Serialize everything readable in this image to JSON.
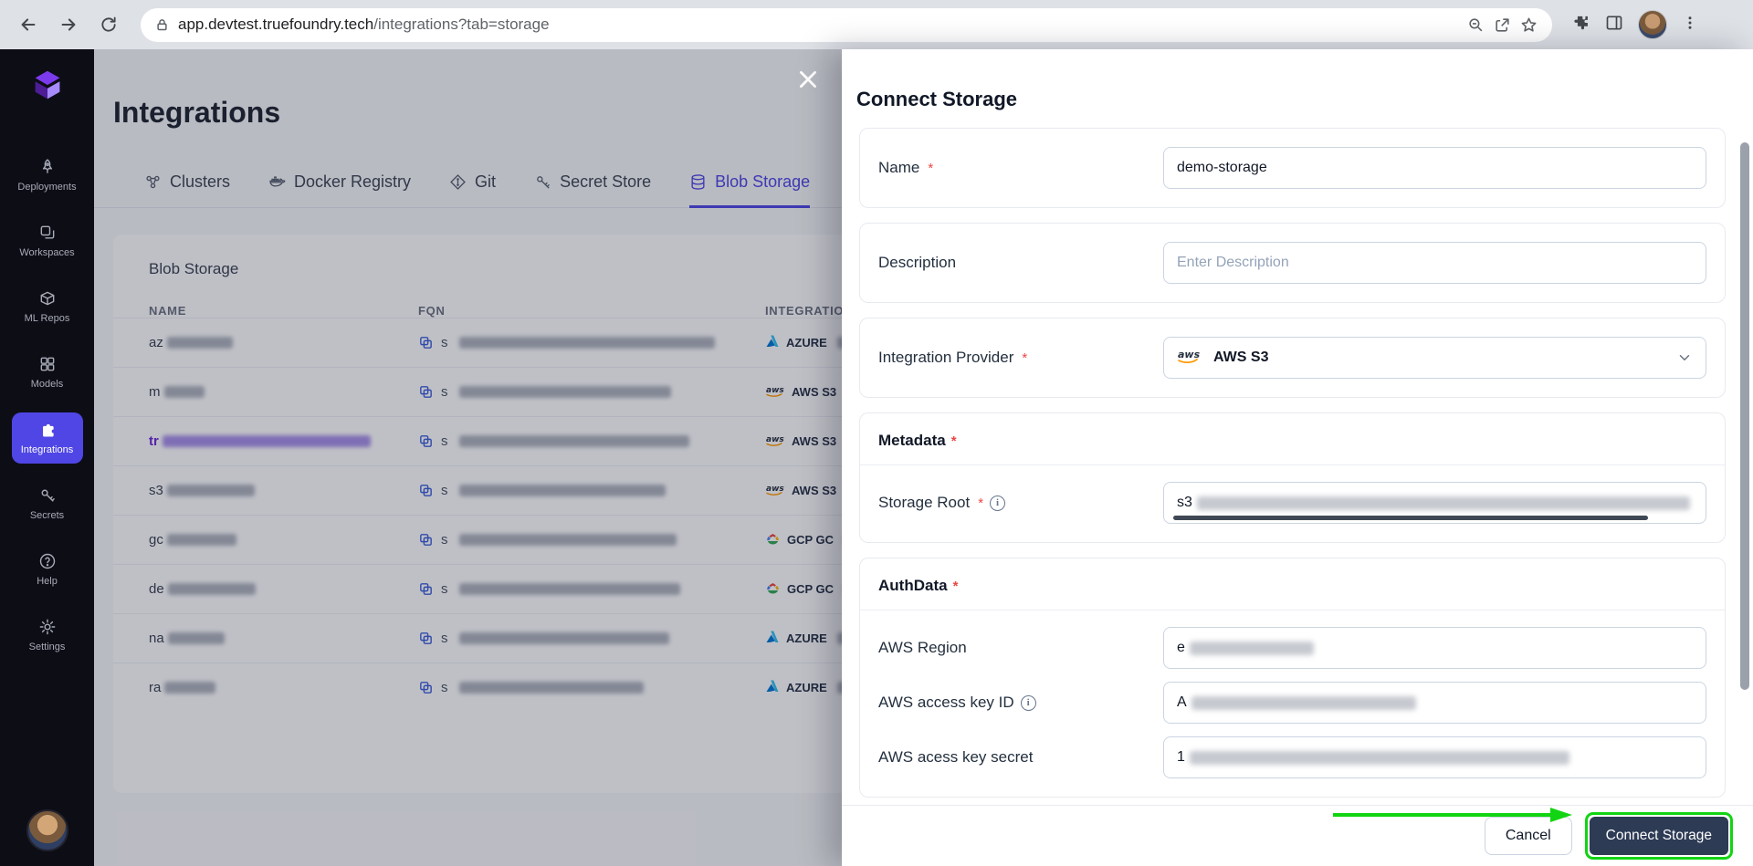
{
  "browser": {
    "url_domain": "app.devtest.truefoundry.tech",
    "url_path": "/integrations?tab=storage"
  },
  "sidebar": {
    "items": [
      {
        "label": "Deployments"
      },
      {
        "label": "Workspaces"
      },
      {
        "label": "ML Repos"
      },
      {
        "label": "Models"
      },
      {
        "label": "Integrations"
      },
      {
        "label": "Secrets"
      },
      {
        "label": "Help"
      },
      {
        "label": "Settings"
      }
    ]
  },
  "page": {
    "title": "Integrations",
    "tabs": [
      {
        "label": "Clusters"
      },
      {
        "label": "Docker Registry"
      },
      {
        "label": "Git"
      },
      {
        "label": "Secret Store"
      },
      {
        "label": "Blob Storage"
      }
    ],
    "panel": {
      "title": "Blob Storage",
      "columns": [
        "NAME",
        "FQN",
        "INTEGRATION"
      ],
      "rows": [
        {
          "name": "az",
          "fqn": "s",
          "badge": "AZURE"
        },
        {
          "name": "m",
          "fqn": "s",
          "badge": "AWS S3"
        },
        {
          "name": "tr",
          "fqn": "s",
          "badge": "AWS S3"
        },
        {
          "name": "s3",
          "fqn": "s",
          "badge": "AWS S3"
        },
        {
          "name": "gc",
          "fqn": "s",
          "badge": "GCP GC"
        },
        {
          "name": "de",
          "fqn": "s",
          "badge": "GCP GC"
        },
        {
          "name": "na",
          "fqn": "s",
          "badge": "AZURE"
        },
        {
          "name": "ra",
          "fqn": "s",
          "badge": "AZURE"
        }
      ]
    }
  },
  "drawer": {
    "title": "Connect Storage",
    "required_marker": "*",
    "name_label": "Name",
    "name_value": "demo-storage",
    "description_label": "Description",
    "description_placeholder": "Enter Description",
    "provider_label": "Integration Provider",
    "provider_value": "AWS S3",
    "metadata_label": "Metadata",
    "storage_root_label": "Storage Root",
    "storage_root_prefix": "s3",
    "authdata_label": "AuthData",
    "region_label": "AWS Region",
    "region_prefix": "e",
    "access_key_label": "AWS access key ID",
    "access_key_prefix": "A",
    "secret_label": "AWS acess key secret",
    "secret_prefix": "1",
    "cancel_label": "Cancel",
    "submit_label": "Connect Storage"
  },
  "colors": {
    "accent": "#4f46e5",
    "highlight_green": "#12d412",
    "submit_bg": "#2e3b55"
  }
}
